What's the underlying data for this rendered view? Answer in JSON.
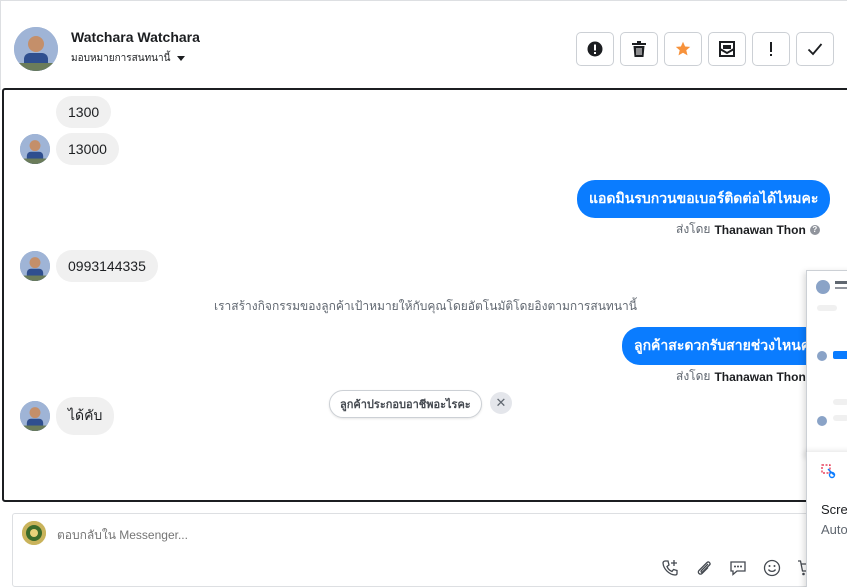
{
  "header": {
    "contact_name": "Watchara Watchara",
    "assign_label": "มอบหมายการสนทนานี้",
    "actions": [
      {
        "icon": "alert-circle-icon",
        "name": "mark-spam-button"
      },
      {
        "icon": "trash-icon",
        "name": "delete-button"
      },
      {
        "icon": "star-icon",
        "name": "star-button",
        "color": "#f7923b"
      },
      {
        "icon": "mark-unread-icon",
        "name": "mark-unread-button"
      },
      {
        "icon": "exclamation-icon",
        "name": "follow-up-button"
      },
      {
        "icon": "check-icon",
        "name": "mark-done-button"
      }
    ]
  },
  "messages": {
    "m1": "1300",
    "m2": "13000",
    "m3": "แอดมินรบกวนขอเบอร์ติดต่อได้ไหมคะ",
    "m3_sent_prefix": "ส่งโดย",
    "m3_sent_name": "Thanawan Thon",
    "m4": "0993144335",
    "system_note": "เราสร้างกิจกรรมของลูกค้าเป้าหมายให้กับคุณโดยอัตโนมัติโดยอิงตามการสนทนานี้",
    "m5": "ลูกค้าสะดวกรับสายช่วงไหนคะ",
    "m5_sent_prefix": "ส่งโดย",
    "m5_sent_name": "Thanawan Thon",
    "m6": "ได้คับ"
  },
  "suggestion": {
    "chip_label": "ลูกค้าประกอบอาชีพอะไรคะ",
    "close_glyph": "✕"
  },
  "composer": {
    "placeholder": "ตอบกลับใน Messenger..."
  },
  "overlay": {
    "line1": "Scre",
    "line2": "Auto"
  },
  "colors": {
    "outgoing_bubble": "#0a7cff",
    "incoming_bubble": "#f0f0f0",
    "star": "#f7923b"
  }
}
